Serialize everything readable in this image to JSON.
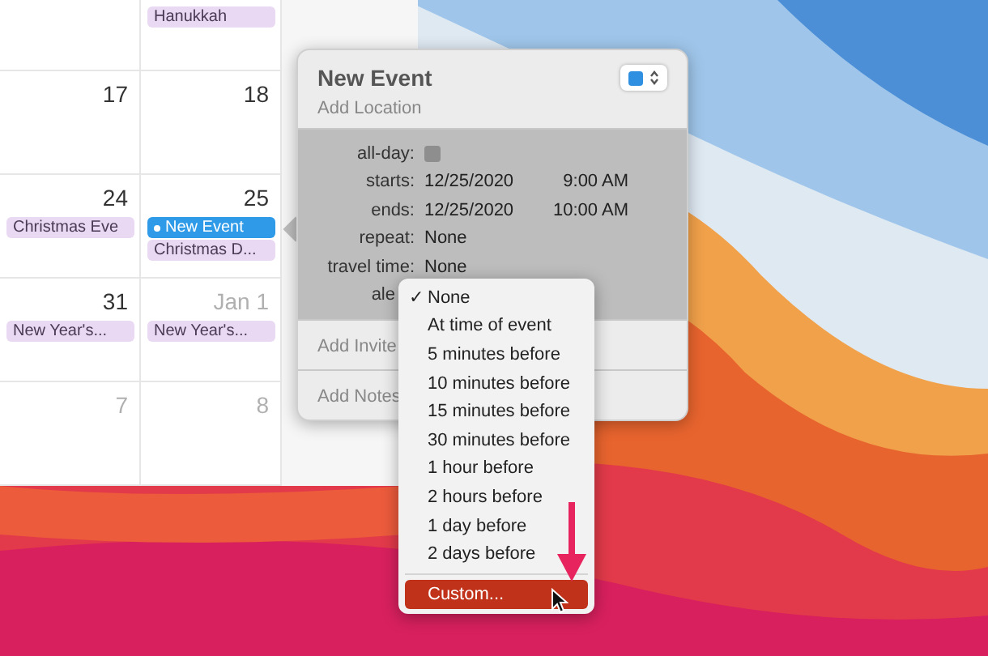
{
  "calendar": {
    "weeks": [
      {
        "days": [
          {
            "events": [
              {
                "title": "Hanukkah",
                "selected": false
              }
            ]
          }
        ]
      },
      {
        "days": [
          {
            "number": "17",
            "dim": false
          },
          {
            "number": "18",
            "dim": false
          }
        ]
      },
      {
        "days": [
          {
            "number": "24",
            "dim": false,
            "events": [
              {
                "title": "Christmas Eve",
                "selected": false
              }
            ]
          },
          {
            "number": "25",
            "dim": false,
            "events": [
              {
                "title": "New Event",
                "selected": true
              },
              {
                "title": "Christmas D...",
                "selected": false
              }
            ]
          }
        ]
      },
      {
        "days": [
          {
            "number": "31",
            "dim": false,
            "events": [
              {
                "title": "New Year's...",
                "selected": false
              }
            ]
          },
          {
            "number": "Jan 1",
            "dim": true,
            "events": [
              {
                "title": "New Year's...",
                "selected": false
              }
            ]
          }
        ]
      },
      {
        "days": [
          {
            "number": "7",
            "dim": true
          },
          {
            "number": "8",
            "dim": true
          }
        ]
      }
    ]
  },
  "popover": {
    "title": "New Event",
    "location_placeholder": "Add Location",
    "fields": [
      {
        "label": "all-day:",
        "kind": "checkbox",
        "checked": false
      },
      {
        "label": "starts:",
        "kind": "datetime",
        "date": "12/25/2020",
        "time": "9:00 AM"
      },
      {
        "label": "ends:",
        "kind": "datetime",
        "date": "12/25/2020",
        "time": "10:00 AM"
      },
      {
        "label": "repeat:",
        "kind": "text",
        "value": "None"
      },
      {
        "label": "travel time:",
        "kind": "text",
        "value": "None"
      },
      {
        "label": "ale",
        "kind": "label"
      }
    ],
    "invitees_placeholder": "Add Invite",
    "notes_placeholder": "Add Notes"
  },
  "alert_menu": {
    "check_mark": "✓",
    "items": [
      {
        "label": "None",
        "selected": true
      },
      {
        "label": "At time of event",
        "selected": false
      },
      {
        "label": "5 minutes before",
        "selected": false
      },
      {
        "label": "10 minutes before",
        "selected": false
      },
      {
        "label": "15 minutes before",
        "selected": false
      },
      {
        "label": "30 minutes before",
        "selected": false
      },
      {
        "label": "1 hour before",
        "selected": false
      },
      {
        "label": "2 hours before",
        "selected": false
      },
      {
        "label": "1 day before",
        "selected": false
      },
      {
        "label": "2 days before",
        "selected": false
      }
    ],
    "custom": {
      "label": "Custom...",
      "highlighted": true
    }
  }
}
